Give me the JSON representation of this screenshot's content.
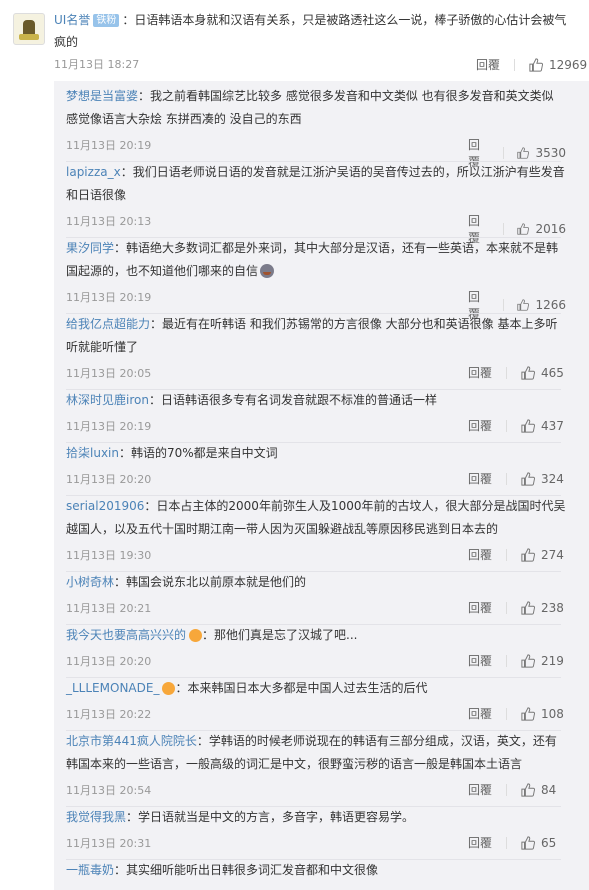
{
  "top_comment": {
    "user": "UI名誉",
    "badge": "铁粉",
    "sep": "：",
    "text": "日语韩语本身就和汉语有关系，只是被路透社这么一说，棒子骄傲的心估计会被气疯的",
    "time": "11月13日 18:27",
    "reply_label": "回覆",
    "likes": "12969"
  },
  "replies": [
    {
      "user": "梦想是当富婆",
      "text": "我之前看韩国综艺比较多  感觉很多发音和中文类似  也有很多发音和英文类似  感觉像语言大杂烩  东拼西凑的 没自己的东西",
      "time": "11月13日 20:19",
      "reply_label": "回覆",
      "likes": "3530"
    },
    {
      "user": "lapizza_x",
      "text": "我们日语老师说日语的发音就是江浙沪吴语的吴音传过去的，所以江浙沪有些发音和日语很像",
      "time": "11月13日 20:13",
      "reply_label": "回覆",
      "likes": "2016"
    },
    {
      "user": "果汐同学",
      "text": "韩语绝大多数词汇都是外来词，其中大部分是汉语，还有一些英语，本来就不是韩国起源的，也不知道他们哪来的自信",
      "time": "11月13日 20:19",
      "reply_label": "回覆",
      "likes": "1266"
    },
    {
      "user": "给我亿点超能力",
      "text": "最近有在听韩语 和我们苏锡常的方言很像 大部分也和英语很像 基本上多听听就能听懂了",
      "time": "11月13日 20:05",
      "reply_label": "回覆",
      "likes": "465"
    },
    {
      "user": "林深时见鹿iron",
      "text": "日语韩语很多专有名词发音就跟不标准的普通话一样",
      "time": "11月13日 20:19",
      "reply_label": "回覆",
      "likes": "437"
    },
    {
      "user": "拾柒luxin",
      "text": "韩语的70%都是来自中文词",
      "time": "11月13日 20:20",
      "reply_label": "回覆",
      "likes": "324"
    },
    {
      "user": "serial201906",
      "text": "日本占主体的2000年前弥生人及1000年前的古坟人，很大部分是战国时代吴越国人，以及五代十国时期江南一带人因为灭国躲避战乱等原因移民逃到日本去的",
      "time": "11月13日 19:30",
      "reply_label": "回覆",
      "likes": "274"
    },
    {
      "user": "小树奇林",
      "text": "韩国会说东北以前原本就是他们的",
      "time": "11月13日 20:21",
      "reply_label": "回覆",
      "likes": "238"
    },
    {
      "user": "我今天也要高高兴兴的",
      "text": "那他们真是忘了汉城了吧...",
      "time": "11月13日 20:20",
      "reply_label": "回覆",
      "likes": "219"
    },
    {
      "user": "_LLLEMONADE_",
      "text": "本来韩国日本大多都是中国人过去生活的后代",
      "time": "11月13日 20:22",
      "reply_label": "回覆",
      "likes": "108"
    },
    {
      "user": "北京市第441疯人院院长",
      "text": "学韩语的时候老师说现在的韩语有三部分组成，汉语，英文，还有韩国本来的一些语言，一般高级的词汇是中文，很野蛮污秽的语言一般是韩国本土语言",
      "time": "11月13日 20:54",
      "reply_label": "回覆",
      "likes": "84"
    },
    {
      "user": "我觉得我黑",
      "text": "学日语就当是中文的方言，多音字，韩语更容易学。",
      "time": "11月13日 20:31",
      "reply_label": "回覆",
      "likes": "65"
    },
    {
      "user": "一瓶毒奶",
      "text": "其实细听能听出日韩很多词汇发音都和中文很像",
      "time": "",
      "reply_label": "",
      "likes": ""
    }
  ],
  "icons": {
    "like": "thumbs-up-icon",
    "avatar": "user-avatar",
    "vip": "vip-badge-icon",
    "emoji": "emoji-icon"
  },
  "colors": {
    "username": "#4c83b7",
    "meta": "#999999",
    "reply_bg": "#f2f2f5",
    "badge": "#97c3ea"
  }
}
